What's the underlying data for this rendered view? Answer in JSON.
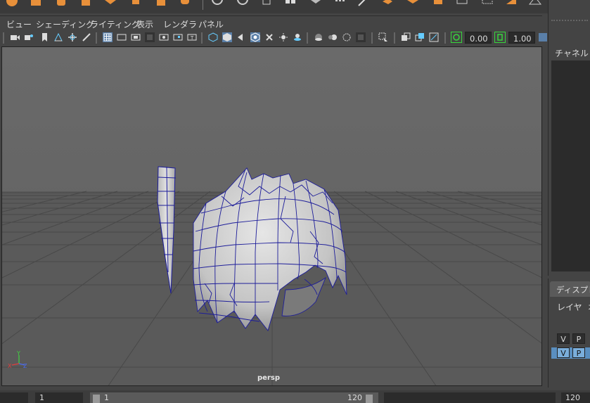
{
  "viewport_menu": [
    "ビュー",
    "シェーディング",
    "ライティング",
    "表示",
    "レンダラ",
    "パネル"
  ],
  "toolbar": {
    "field1_value": "0.00",
    "field2_value": "1.00"
  },
  "viewport": {
    "camera_label": "persp"
  },
  "channel_box": {
    "title": "チャネル"
  },
  "display_panel": {
    "tab_label": "ディスプレイ",
    "menu": [
      "レイヤ",
      "オ"
    ],
    "row1": [
      "V",
      "P"
    ],
    "row2": [
      "V",
      "P"
    ]
  },
  "time_slider": {
    "start_field": "1",
    "range_start": "1",
    "range_end": "120",
    "end_field": "120"
  },
  "colors": {
    "accent_orange": "#e8903a",
    "toggle_green": "#37d63c",
    "wire_blue": "#1d1d9a",
    "selected_blue": "#5a95c4"
  }
}
